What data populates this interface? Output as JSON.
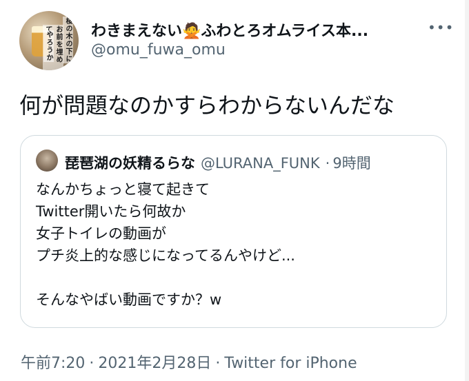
{
  "author": {
    "name": "わきまえない",
    "name_emoji": "🙅",
    "name_suffix": "ふわとろオムライス本...",
    "handle": "@omu_fuwa_omu",
    "avatar_text": [
      "桜の木の下に",
      "お前を埋めて",
      "やろうか"
    ]
  },
  "menu": {
    "icon": "more-icon",
    "label": "•••"
  },
  "tweet": {
    "text": "何が問題なのかすらわからないんだな"
  },
  "quoted_tweet": {
    "name": "琵琶湖の妖精るらな",
    "handle": "@LURANA_FUNK",
    "separator": "·",
    "time": "9時間",
    "body": "なんかちょっと寝て起きて\nTwitter開いたら何故か\n女子トイレの動画が\nプチ炎上的な感じになってるんやけど...\n\nそんなやばい動画ですか？w"
  },
  "footer": {
    "time": "午前7:20",
    "date": "2021年2月28日",
    "separator": "·",
    "source": "Twitter for iPhone"
  },
  "colors": {
    "text": "#0f1419",
    "secondary": "#536471",
    "border": "#cfd9de"
  }
}
